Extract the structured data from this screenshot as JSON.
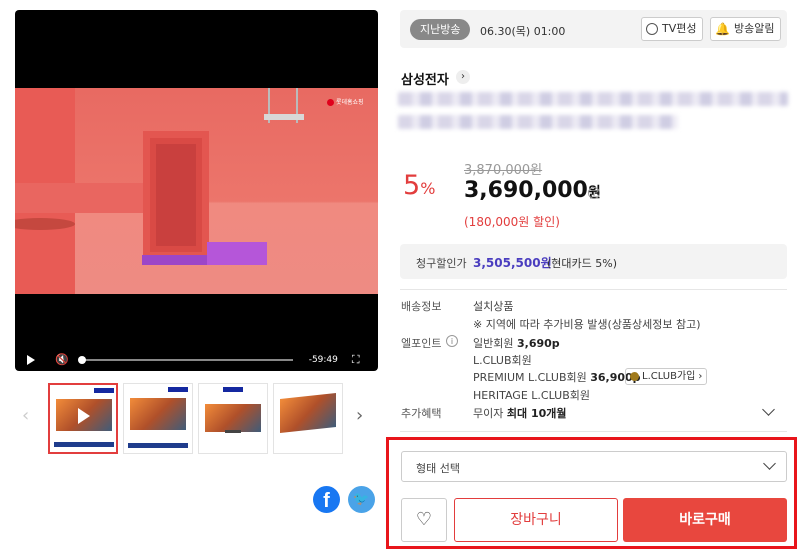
{
  "video": {
    "channel_logo": "롯데홈쇼핑",
    "time_remaining": "-59:49"
  },
  "broadcast": {
    "badge": "지난방송",
    "date": "06.30(목) 01:00",
    "tv_schedule_label": "TV편성",
    "alert_label": "방송알림"
  },
  "product": {
    "seller": "삼성전자",
    "discount_rate": "5",
    "discount_unit": "%",
    "original_price": "3,870,000원",
    "price": "3,690,000",
    "price_unit": "원",
    "saving": "(180,000원 할인)"
  },
  "billing": {
    "label": "청구할인가",
    "price": "3,505,500원",
    "note": "(현대카드 5%)"
  },
  "details": {
    "shipping_label": "배송정보",
    "shipping_value": "설치상품",
    "shipping_note": "※ 지역에 따라 추가비용 발생(상품상세정보 참고)",
    "lpoint_label": "엘포인트",
    "lpoint_general": "일반회원",
    "lpoint_general_value": "3,690p",
    "lpoint_lclub": "L.CLUB회원",
    "lpoint_premium": "PREMIUM L.CLUB회원",
    "lpoint_premium_value": "36,900p",
    "lpoint_heritage": "HERITAGE L.CLUB회원",
    "lclub_join": "L.CLUB가입",
    "benefit_label": "추가혜택",
    "benefit_value_prefix": "무이자",
    "benefit_value_strong": "최대 10개월"
  },
  "purchase": {
    "option_placeholder": "형태 선택",
    "cart_label": "장바구니",
    "buy_label": "바로구매"
  }
}
